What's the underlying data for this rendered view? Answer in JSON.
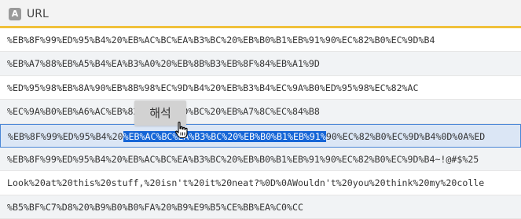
{
  "header": {
    "badge": "A",
    "title": "URL"
  },
  "rows": [
    {
      "text": "%EB%8F%99%ED%95%B4%20%EB%AC%BC%EA%B3%BC%20%EB%B0%B1%EB%91%90%EC%82%B0%EC%9D%B4"
    },
    {
      "text": "%EB%A7%88%EB%A5%B4%EA%B3%A0%20%EB%8B%B3%EB%8F%84%EB%A1%9D"
    },
    {
      "text": "%ED%95%98%EB%8A%90%EB%8B%98%EC%9D%B4%20%EB%B3%B4%EC%9A%B0%ED%95%98%EC%82%AC"
    },
    {
      "text": "%EC%9A%B0%EB%A6%AC%EB%82%98%EB%9D%BC%20%EB%A7%8C%EC%84%B8"
    },
    {
      "before": "%EB%8F%99%ED%95%B4%20",
      "highlight": "%EB%AC%BC%EA%B3%BC%20%EB%B0%B1%EB%91%",
      "after": "90%EC%82%B0%EC%9D%B4%0D%0A%ED"
    },
    {
      "text": "%EB%8F%99%ED%95%B4%20%EB%AC%BC%EA%B3%BC%20%EB%B0%B1%EB%91%90%EC%82%B0%EC%9D%B4~!@#$%25"
    },
    {
      "text": "Look%20at%20this%20stuff,%20isn't%20it%20neat?%0D%0AWouldn't%20you%20think%20my%20colle"
    },
    {
      "text": "%B5%BF%C7%D8%20%B9%B0%B0%FA%20%B9%E9%B5%CE%BB%EA%C0%CC"
    }
  ],
  "tooltip": {
    "label": "해석"
  },
  "icons": {
    "cursor": "hand-pointer-icon"
  },
  "colors": {
    "header_underline": "#f0c13a",
    "selection_highlight": "#1565d6",
    "selected_row_border": "#4a86d6"
  }
}
